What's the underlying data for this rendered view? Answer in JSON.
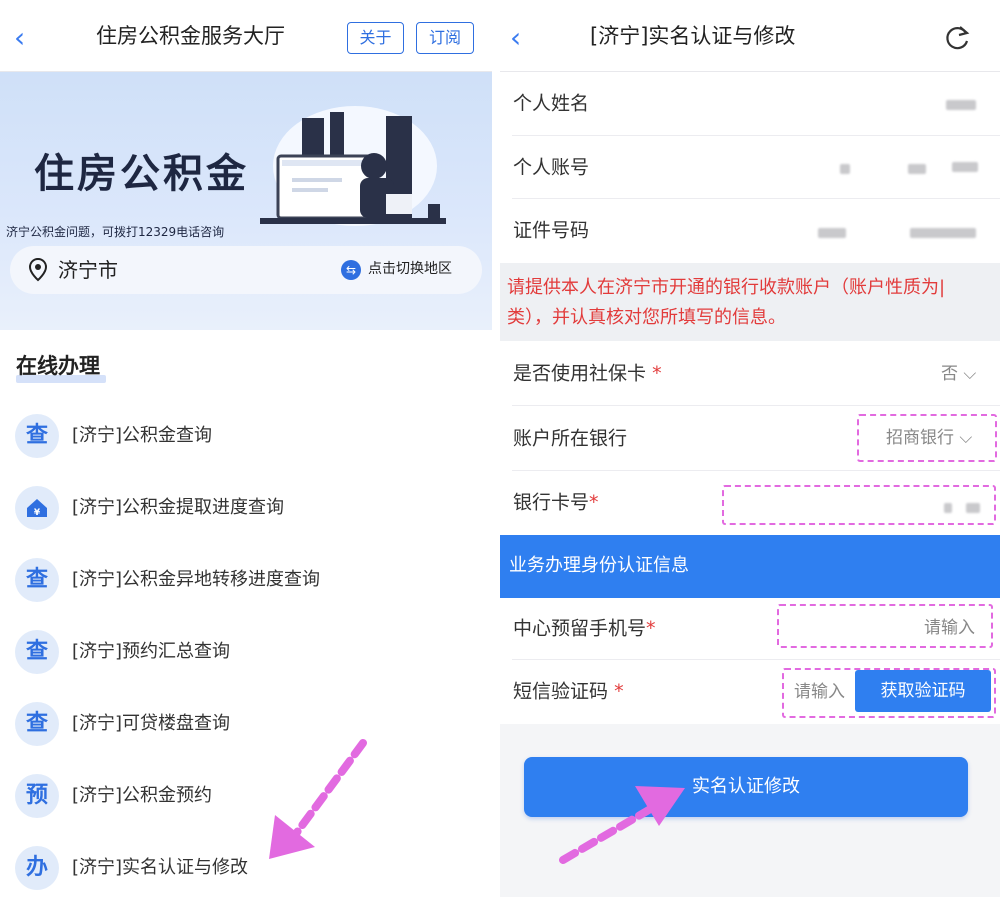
{
  "left": {
    "nav": {
      "title": "住房公积金服务大厅",
      "about_label": "关于",
      "subscribe_label": "订阅"
    },
    "banner": {
      "title": "住房公积金",
      "tip": "济宁公积金问题，可拨打12329电话咨询"
    },
    "city": {
      "name": "济宁市",
      "switch_label": "点击切换地区"
    },
    "section_title": "在线办理",
    "items": [
      {
        "icon_text": "查",
        "label": "[济宁]公积金查询"
      },
      {
        "icon_text": "",
        "icon": "house-yuan-icon",
        "label": "[济宁]公积金提取进度查询"
      },
      {
        "icon_text": "查",
        "label": "[济宁]公积金异地转移进度查询"
      },
      {
        "icon_text": "查",
        "label": "[济宁]预约汇总查询"
      },
      {
        "icon_text": "查",
        "label": "[济宁]可贷楼盘查询"
      },
      {
        "icon_text": "预",
        "label": "[济宁]公积金预约"
      },
      {
        "icon_text": "办",
        "label": "[济宁]实名认证与修改"
      }
    ]
  },
  "right": {
    "nav": {
      "title": "[济宁]实名认证与修改"
    },
    "fields": {
      "name_label": "个人姓名",
      "account_label": "个人账号",
      "id_label": "证件号码"
    },
    "notice": "请提供本人在济宁市开通的银行收款账户（账户性质为|类），并认真核对您所填写的信息。",
    "social_card": {
      "label": "是否使用社保卡",
      "required": "*",
      "value": "否"
    },
    "bank": {
      "label": "账户所在银行",
      "value": "招商银行"
    },
    "card_no": {
      "label": "银行卡号",
      "required": "*"
    },
    "section_bar": "业务办理身份认证信息",
    "phone": {
      "label": "中心预留手机号",
      "required": "*",
      "placeholder": "请输入"
    },
    "sms": {
      "label": "短信验证码",
      "required": "*",
      "placeholder": "请输入",
      "button": "获取验证码"
    },
    "submit": "实名认证修改"
  },
  "colors": {
    "accent": "#2f7ff0",
    "warning_text": "#e23b3b",
    "annotation": "#e26ae0"
  }
}
